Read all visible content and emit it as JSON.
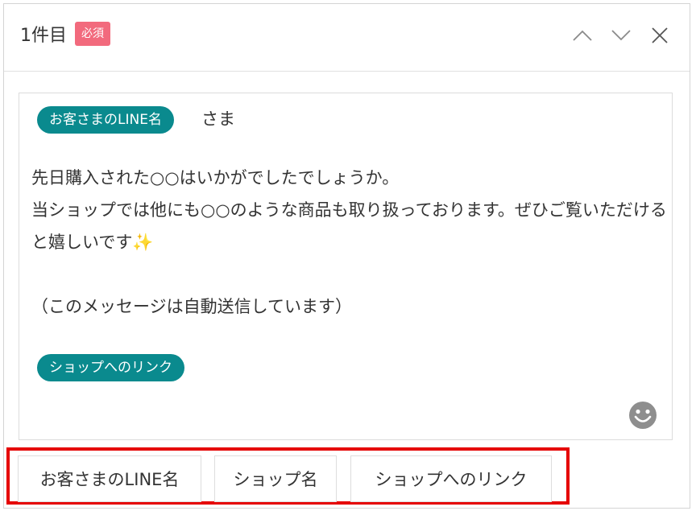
{
  "header": {
    "title": "1件目",
    "badge": "必須",
    "controls": [
      "chevron-up-icon",
      "chevron-down-icon",
      "close-icon"
    ]
  },
  "editor": {
    "recipient_tag": "お客さまのLINE名",
    "honorific": "さま",
    "body": "先日購入された○○はいかがでしたでしょうか。\n当ショップでは他にも○○のような商品も取り扱っております。ぜひご覧いただけると嬉しいです✨\n\n（このメッセージは自動送信しています）",
    "link_tag": "ショップへのリンク",
    "emoji_icon": "smiley-icon"
  },
  "insert_buttons": [
    {
      "label": "お客さまのLINE名"
    },
    {
      "label": "ショップ名"
    },
    {
      "label": "ショップへのリンク"
    }
  ],
  "colors": {
    "accent_teal": "#0a8a8e",
    "required_badge": "#f26a7d",
    "highlight_border": "#e50000"
  }
}
